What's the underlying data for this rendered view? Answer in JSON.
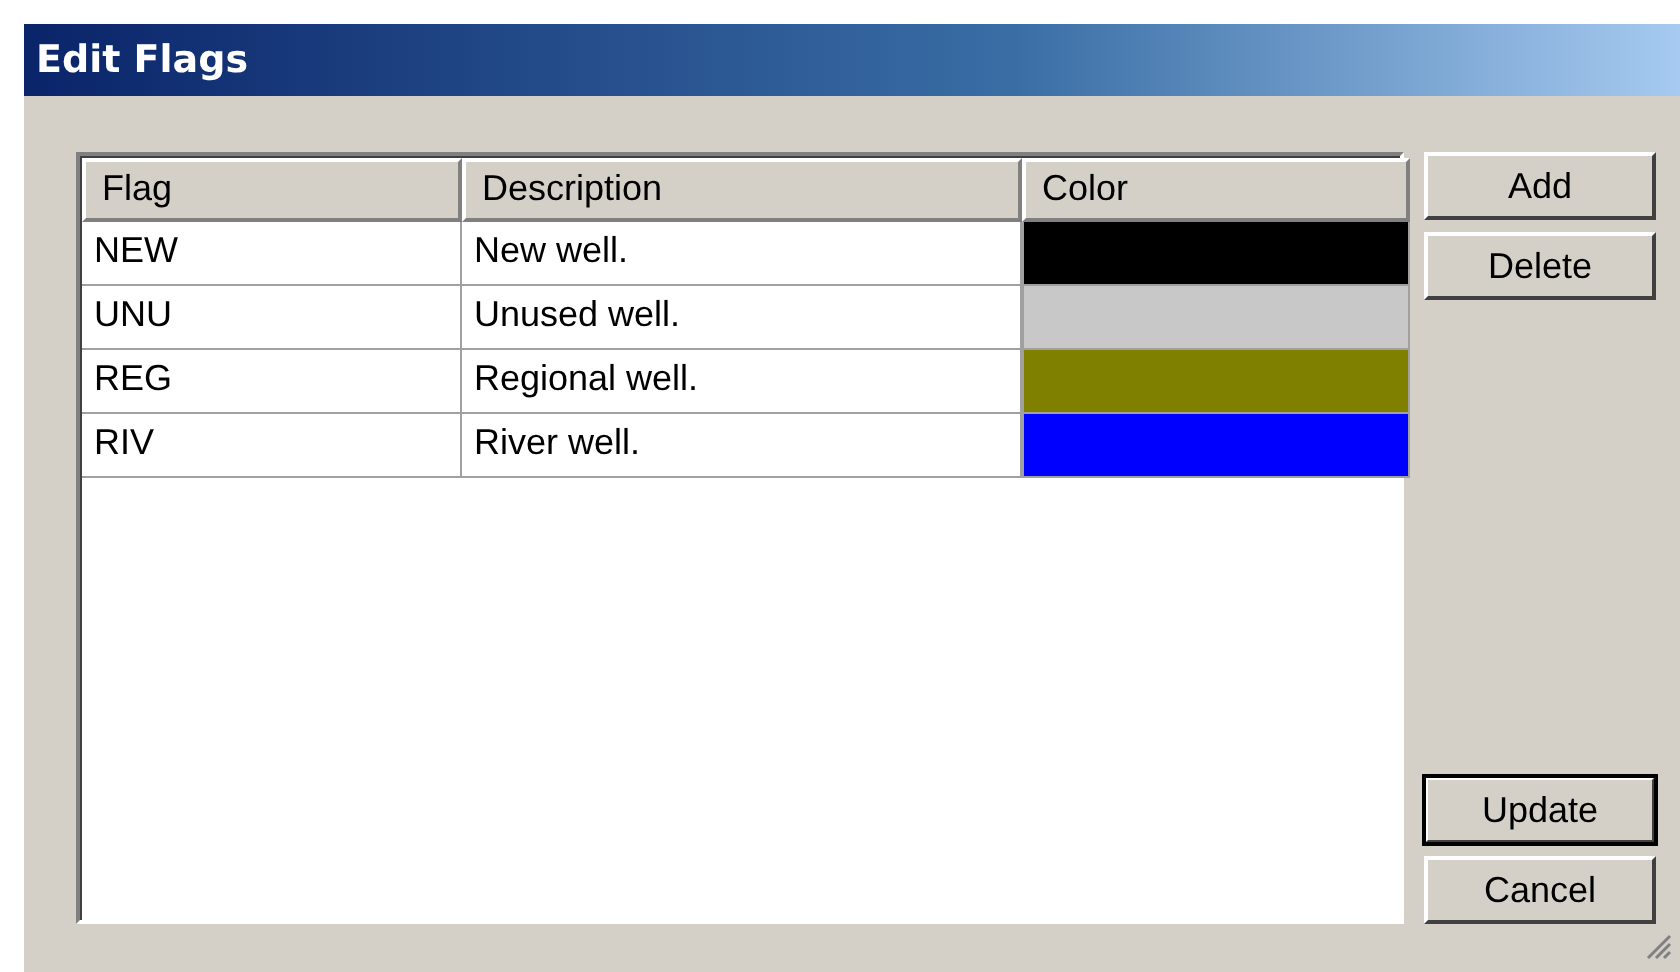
{
  "window": {
    "title": "Edit Flags"
  },
  "table": {
    "columns": [
      "Flag",
      "Description",
      "Color"
    ],
    "rows": [
      {
        "flag": "NEW",
        "description": "New well.",
        "color": "#000000"
      },
      {
        "flag": "UNU",
        "description": "Unused well.",
        "color": "#c8c8c8"
      },
      {
        "flag": "REG",
        "description": "Regional well.",
        "color": "#808000"
      },
      {
        "flag": "RIV",
        "description": "River well.",
        "color": "#0000ff"
      }
    ]
  },
  "top_buttons": [
    {
      "label": "Add",
      "default": false
    },
    {
      "label": "Delete",
      "default": false
    }
  ],
  "bottom_buttons": [
    {
      "label": "Update",
      "default": true
    },
    {
      "label": "Cancel",
      "default": false
    }
  ]
}
